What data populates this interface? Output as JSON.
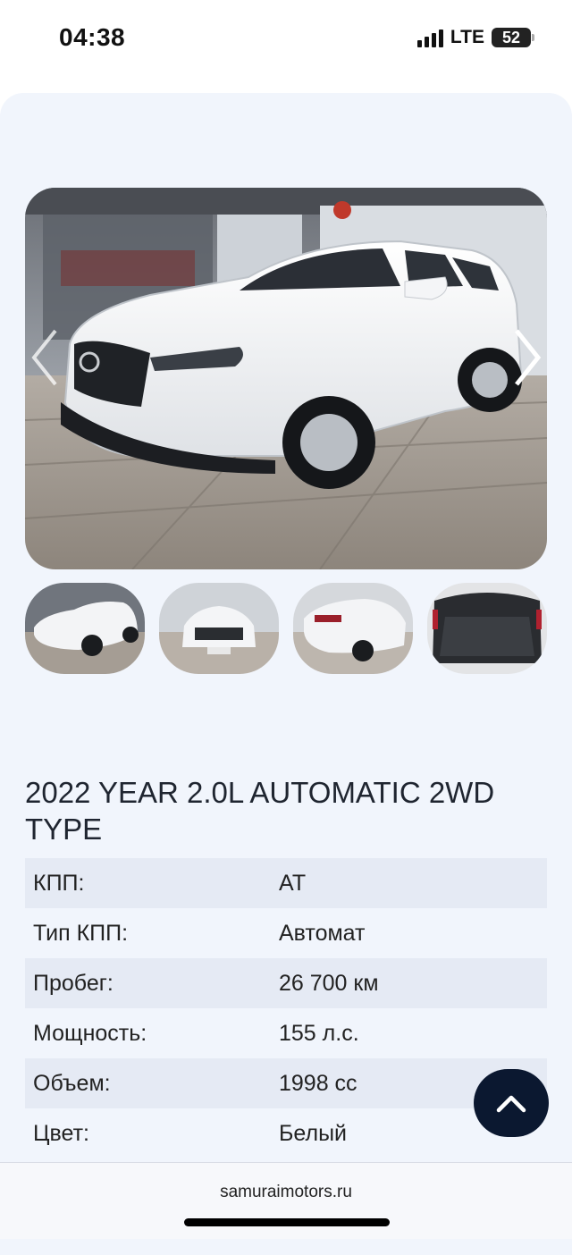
{
  "status_bar": {
    "time": "04:38",
    "network": "LTE",
    "battery_level": "52"
  },
  "gallery": {
    "main_image": "white-mazda-cx5-showroom-front",
    "prev_icon": "chevron-left-icon",
    "next_icon": "chevron-right-icon",
    "thumbnails": [
      "car-front-side-thumbnail",
      "car-front-thumbnail",
      "car-rear-side-thumbnail",
      "trunk-interior-thumbnail"
    ]
  },
  "listing": {
    "title": "2022 YEAR 2.0L AUTOMATIC 2WD TYPE",
    "specs": [
      {
        "label": "КПП:",
        "value": "AT"
      },
      {
        "label": "Тип КПП:",
        "value": "Автомат"
      },
      {
        "label": "Пробег:",
        "value": "26 700 км"
      },
      {
        "label": "Мощность:",
        "value": "155 л.с."
      },
      {
        "label": "Объем:",
        "value": "1998 cc"
      },
      {
        "label": "Цвет:",
        "value": "Белый"
      }
    ]
  },
  "scroll_top_icon": "chevron-up-icon",
  "browser": {
    "domain": "samuraimotors.ru"
  },
  "colors": {
    "page_background": "#f1f5fc",
    "row_alt": "#e5eaf4",
    "scroll_button": "#0b1830",
    "text": "#1f2530"
  }
}
